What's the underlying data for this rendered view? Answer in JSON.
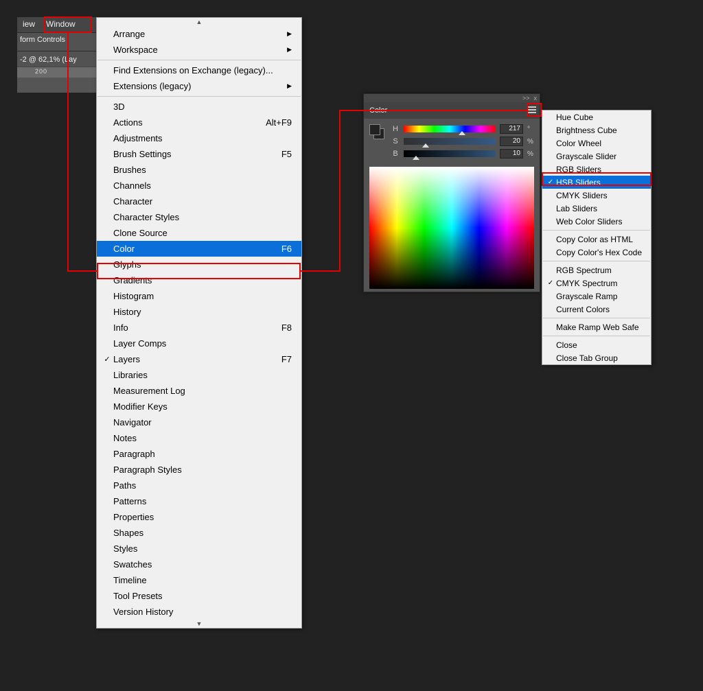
{
  "menubar": {
    "view": "iew",
    "window": "Window"
  },
  "options_bar": {
    "label": "form Controls"
  },
  "doc_tab": {
    "label": "-2 @ 62,1% (Lay"
  },
  "ruler": {
    "tick": "200"
  },
  "window_menu": {
    "scroll_up": "▲",
    "scroll_down": "▼",
    "groups": [
      [
        {
          "label": "Arrange",
          "submenu": true
        },
        {
          "label": "Workspace",
          "submenu": true
        }
      ],
      [
        {
          "label": "Find Extensions on Exchange (legacy)..."
        },
        {
          "label": "Extensions (legacy)",
          "submenu": true
        }
      ],
      [
        {
          "label": "3D"
        },
        {
          "label": "Actions",
          "shortcut": "Alt+F9"
        },
        {
          "label": "Adjustments"
        },
        {
          "label": "Brush Settings",
          "shortcut": "F5"
        },
        {
          "label": "Brushes"
        },
        {
          "label": "Channels"
        },
        {
          "label": "Character"
        },
        {
          "label": "Character Styles"
        },
        {
          "label": "Clone Source"
        },
        {
          "label": "Color",
          "shortcut": "F6",
          "selected": true
        },
        {
          "label": "Glyphs"
        },
        {
          "label": "Gradients"
        },
        {
          "label": "Histogram"
        },
        {
          "label": "History"
        },
        {
          "label": "Info",
          "shortcut": "F8"
        },
        {
          "label": "Layer Comps"
        },
        {
          "label": "Layers",
          "shortcut": "F7",
          "checked": true
        },
        {
          "label": "Libraries"
        },
        {
          "label": "Measurement Log"
        },
        {
          "label": "Modifier Keys"
        },
        {
          "label": "Navigator"
        },
        {
          "label": "Notes"
        },
        {
          "label": "Paragraph"
        },
        {
          "label": "Paragraph Styles"
        },
        {
          "label": "Paths"
        },
        {
          "label": "Patterns"
        },
        {
          "label": "Properties"
        },
        {
          "label": "Shapes"
        },
        {
          "label": "Styles"
        },
        {
          "label": "Swatches"
        },
        {
          "label": "Timeline"
        },
        {
          "label": "Tool Presets"
        },
        {
          "label": "Version History"
        }
      ]
    ]
  },
  "color_panel": {
    "title": "Color",
    "sliders": {
      "h": {
        "label": "H",
        "value": "217",
        "unit": "°",
        "pos": 60
      },
      "s": {
        "label": "S",
        "value": "20",
        "unit": "%",
        "pos": 20
      },
      "b": {
        "label": "B",
        "value": "10",
        "unit": "%",
        "pos": 10
      }
    },
    "collapse_glyph": ">>",
    "close_glyph": "x"
  },
  "flyout_menu": {
    "groups": [
      [
        {
          "label": "Hue Cube"
        },
        {
          "label": "Brightness Cube"
        },
        {
          "label": "Color Wheel"
        },
        {
          "label": "Grayscale Slider"
        },
        {
          "label": "RGB Sliders"
        },
        {
          "label": "HSB Sliders",
          "checked": true,
          "selected": true
        },
        {
          "label": "CMYK Sliders"
        },
        {
          "label": "Lab Sliders"
        },
        {
          "label": "Web Color Sliders"
        }
      ],
      [
        {
          "label": "Copy Color as HTML"
        },
        {
          "label": "Copy Color's Hex Code"
        }
      ],
      [
        {
          "label": "RGB Spectrum"
        },
        {
          "label": "CMYK Spectrum",
          "checked": true
        },
        {
          "label": "Grayscale Ramp"
        },
        {
          "label": "Current Colors"
        }
      ],
      [
        {
          "label": "Make Ramp Web Safe"
        }
      ],
      [
        {
          "label": "Close"
        },
        {
          "label": "Close Tab Group"
        }
      ]
    ]
  }
}
